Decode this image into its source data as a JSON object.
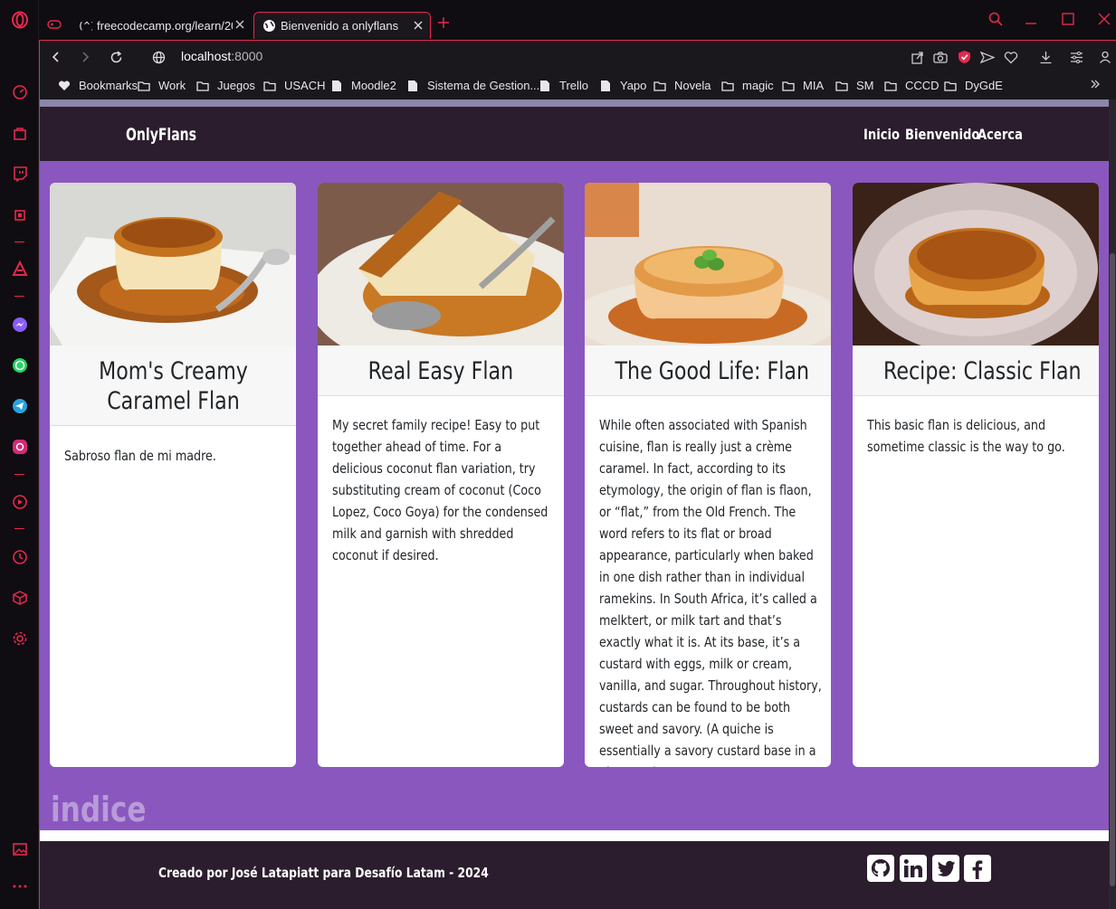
{
  "browser": {
    "tabs": [
      {
        "title": "freecodecamp.org/learn/20",
        "favicon": "freecodecamp-icon",
        "active": false
      },
      {
        "title": "Bienvenido a onlyflans",
        "favicon": "globe-icon",
        "active": true
      }
    ],
    "address": {
      "host": "localhost",
      "port": ":8000"
    },
    "bookmarks": [
      {
        "label": "Bookmarks",
        "icon": "heart-icon"
      },
      {
        "label": "Work",
        "icon": "folder-icon"
      },
      {
        "label": "Juegos",
        "icon": "folder-icon"
      },
      {
        "label": "USACH",
        "icon": "folder-icon"
      },
      {
        "label": "Moodle2",
        "icon": "page-icon"
      },
      {
        "label": "Sistema de Gestion...",
        "icon": "page-icon"
      },
      {
        "label": "Trello",
        "icon": "page-icon"
      },
      {
        "label": "Yapo",
        "icon": "page-icon"
      },
      {
        "label": "Novela",
        "icon": "folder-icon"
      },
      {
        "label": "magic",
        "icon": "folder-icon"
      },
      {
        "label": "MIA",
        "icon": "folder-icon"
      },
      {
        "label": "SM",
        "icon": "folder-icon"
      },
      {
        "label": "CCCD",
        "icon": "folder-icon"
      },
      {
        "label": "DyGdE",
        "icon": "folder-icon"
      }
    ],
    "accent_color": "#e6284e"
  },
  "site": {
    "brand": "OnlyFlans",
    "nav": [
      "Inicio",
      "Bienvenido",
      "Acerca"
    ],
    "cards": [
      {
        "title_lines": [
          "Mom's Creamy",
          "Caramel Flan"
        ],
        "text": "Sabroso flan de mi madre."
      },
      {
        "title_lines": [
          "Real Easy Flan"
        ],
        "text": "My secret family recipe! Easy to put together ahead of time. For a delicious coconut flan variation, try substituting cream of coconut (Coco Lopez, Coco Goya) for the condensed milk and garnish with shredded coconut if desired."
      },
      {
        "title_lines": [
          "The Good Life: Flan"
        ],
        "text": "While often associated with Spanish cuisine, flan is really just a crème caramel. In fact, according to its etymology, the origin of flan is flaon, or “flat,” from the Old French. The word refers to its flat or broad appearance, particularly when baked in one dish rather than in individual ramekins. In South Africa, it’s called a melktert, or milk tart and that’s exactly what it is. At its base, it’s a custard with eggs, milk or cream, vanilla, and sugar. Throughout history, custards can be found to be both sweet and savory. (A quiche is essentially a savory custard base in a pie crust.)"
      },
      {
        "title_lines": [
          "Recipe: Classic Flan"
        ],
        "text": "This basic flan is delicious, and sometime classic is the way to go."
      }
    ],
    "section_heading": "indice",
    "footer_text": "Creado por José Latapiatt para Desafío Latam - 2024",
    "social_icons": [
      "github-icon",
      "linkedin-icon",
      "twitter-icon",
      "facebook-icon"
    ],
    "colors": {
      "page_bg": "#8a57bf",
      "nav_bg": "#2b1d2d",
      "heading_faded": "#b99bd8"
    }
  }
}
